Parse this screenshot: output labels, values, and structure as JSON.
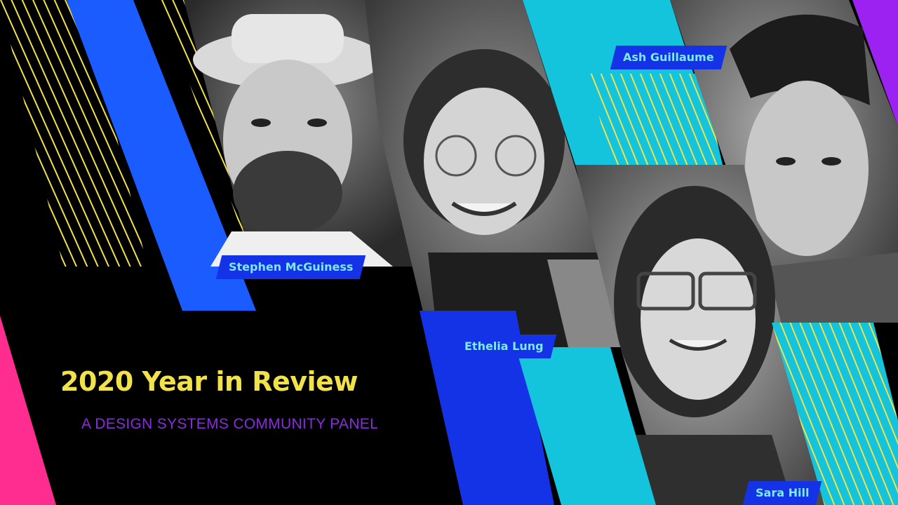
{
  "title": "2020 Year in Review",
  "subtitle": "A DESIGN SYSTEMS COMMUNITY PANEL",
  "panelists": [
    {
      "name": "Stephen McGuiness"
    },
    {
      "name": "Ethelia Lung"
    },
    {
      "name": "Ash Guillaume"
    },
    {
      "name": "Sara Hill"
    }
  ],
  "colors": {
    "background": "#000000",
    "title_yellow": "#f2e24a",
    "subtitle_purple": "#8a2be2",
    "blue": "#1a5cff",
    "cyan": "#14c3dc",
    "pink": "#ff2d8f",
    "violet": "#9b22f0",
    "tag_bg": "#1433e6",
    "tag_text": "#7ee8f5"
  }
}
